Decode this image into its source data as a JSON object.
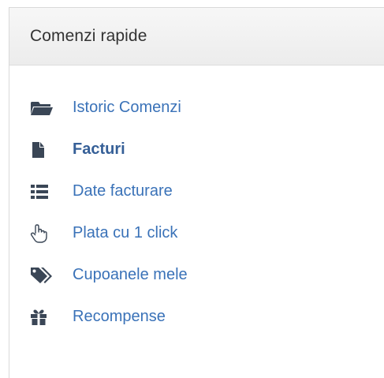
{
  "panel": {
    "title": "Comenzi rapide"
  },
  "menu": {
    "items": [
      {
        "label": "Istoric Comenzi",
        "icon": "folder-open-icon",
        "active": false
      },
      {
        "label": "Facturi",
        "icon": "file-icon",
        "active": true
      },
      {
        "label": "Date facturare",
        "icon": "list-icon",
        "active": false
      },
      {
        "label": "Plata cu 1 click",
        "icon": "hand-pointer-icon",
        "active": false
      },
      {
        "label": "Cupoanele mele",
        "icon": "tags-icon",
        "active": false
      },
      {
        "label": "Recompense",
        "icon": "gift-icon",
        "active": false
      }
    ]
  },
  "colors": {
    "link": "#3a72b8",
    "active_link": "#355f97",
    "icon": "#3a4656",
    "header_bg": "#efefef",
    "border": "#d9d9d9"
  }
}
